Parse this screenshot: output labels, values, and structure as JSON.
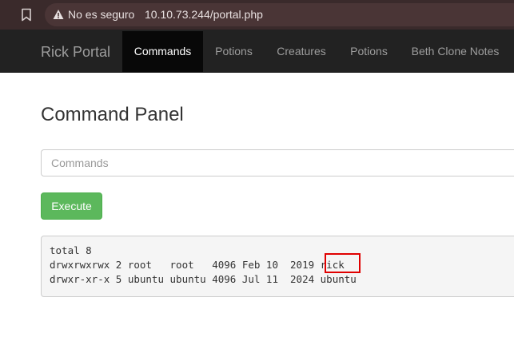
{
  "browser": {
    "security_label": "No es seguro",
    "url": "10.10.73.244/portal.php"
  },
  "navbar": {
    "brand": "Rick Portal",
    "items": [
      {
        "label": "Commands",
        "active": true
      },
      {
        "label": "Potions",
        "active": false
      },
      {
        "label": "Creatures",
        "active": false
      },
      {
        "label": "Potions",
        "active": false
      },
      {
        "label": "Beth Clone Notes",
        "active": false
      }
    ]
  },
  "main": {
    "title": "Command Panel",
    "command_input": {
      "value": "",
      "placeholder": "Commands"
    },
    "execute_label": "Execute",
    "output_lines": [
      "total 8",
      "drwxrwxrwx 2 root   root   4096 Feb 10  2019 rick",
      "drwxr-xr-x 5 ubuntu ubuntu 4096 Jul 11  2024 ubuntu"
    ]
  },
  "colors": {
    "browser_bar": "#3a2a2b",
    "navbar": "#222222",
    "nav_active": "#080808",
    "execute_button": "#5cb85c",
    "highlight": "#e00000"
  },
  "icons": {
    "bookmark": "bookmark-icon",
    "security": "warning-icon"
  }
}
